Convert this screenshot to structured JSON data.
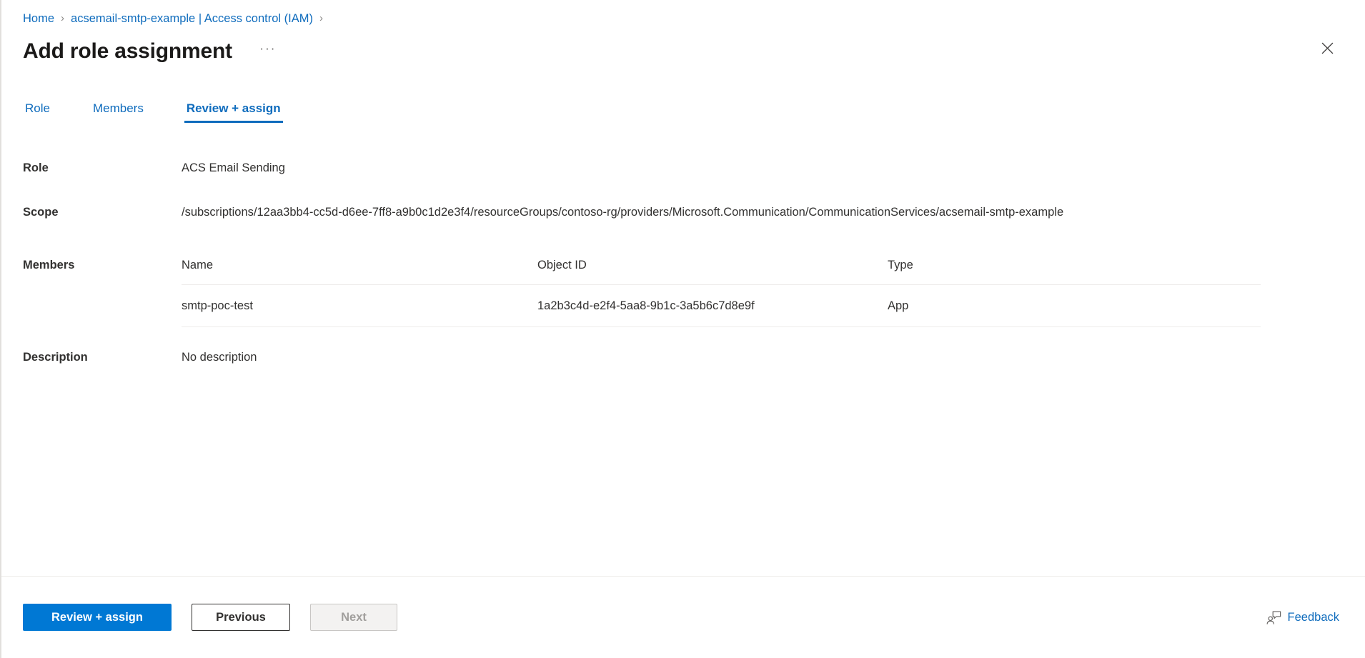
{
  "breadcrumb": {
    "items": [
      {
        "label": "Home"
      },
      {
        "label": "acsemail-smtp-example | Access control (IAM)"
      }
    ],
    "separator": "›"
  },
  "header": {
    "title": "Add role assignment",
    "more_menu": "···",
    "close_label": "Close"
  },
  "tabs": [
    {
      "label": "Role",
      "active": false
    },
    {
      "label": "Members",
      "active": false
    },
    {
      "label": "Review + assign",
      "active": true
    }
  ],
  "fields": {
    "role_label": "Role",
    "role_value": "ACS Email Sending",
    "scope_label": "Scope",
    "scope_value": "/subscriptions/12aa3bb4-cc5d-d6ee-7ff8-a9b0c1d2e3f4/resourceGroups/contoso-rg/providers/Microsoft.Communication/CommunicationServices/acsemail-smtp-example",
    "members_label": "Members",
    "description_label": "Description",
    "description_value": "No description"
  },
  "members_table": {
    "columns": [
      "Name",
      "Object ID",
      "Type"
    ],
    "rows": [
      {
        "name": "smtp-poc-test",
        "object_id": "1a2b3c4d-e2f4-5aa8-9b1c-3a5b6c7d8e9f",
        "type": "App"
      }
    ]
  },
  "footer": {
    "primary_button": "Review + assign",
    "previous_button": "Previous",
    "next_button": "Next",
    "feedback_label": "Feedback"
  },
  "colors": {
    "accent": "#0078d4",
    "link": "#0f6cbd",
    "text": "#323130",
    "border": "#edebe9",
    "disabled_text": "#a19f9d"
  }
}
